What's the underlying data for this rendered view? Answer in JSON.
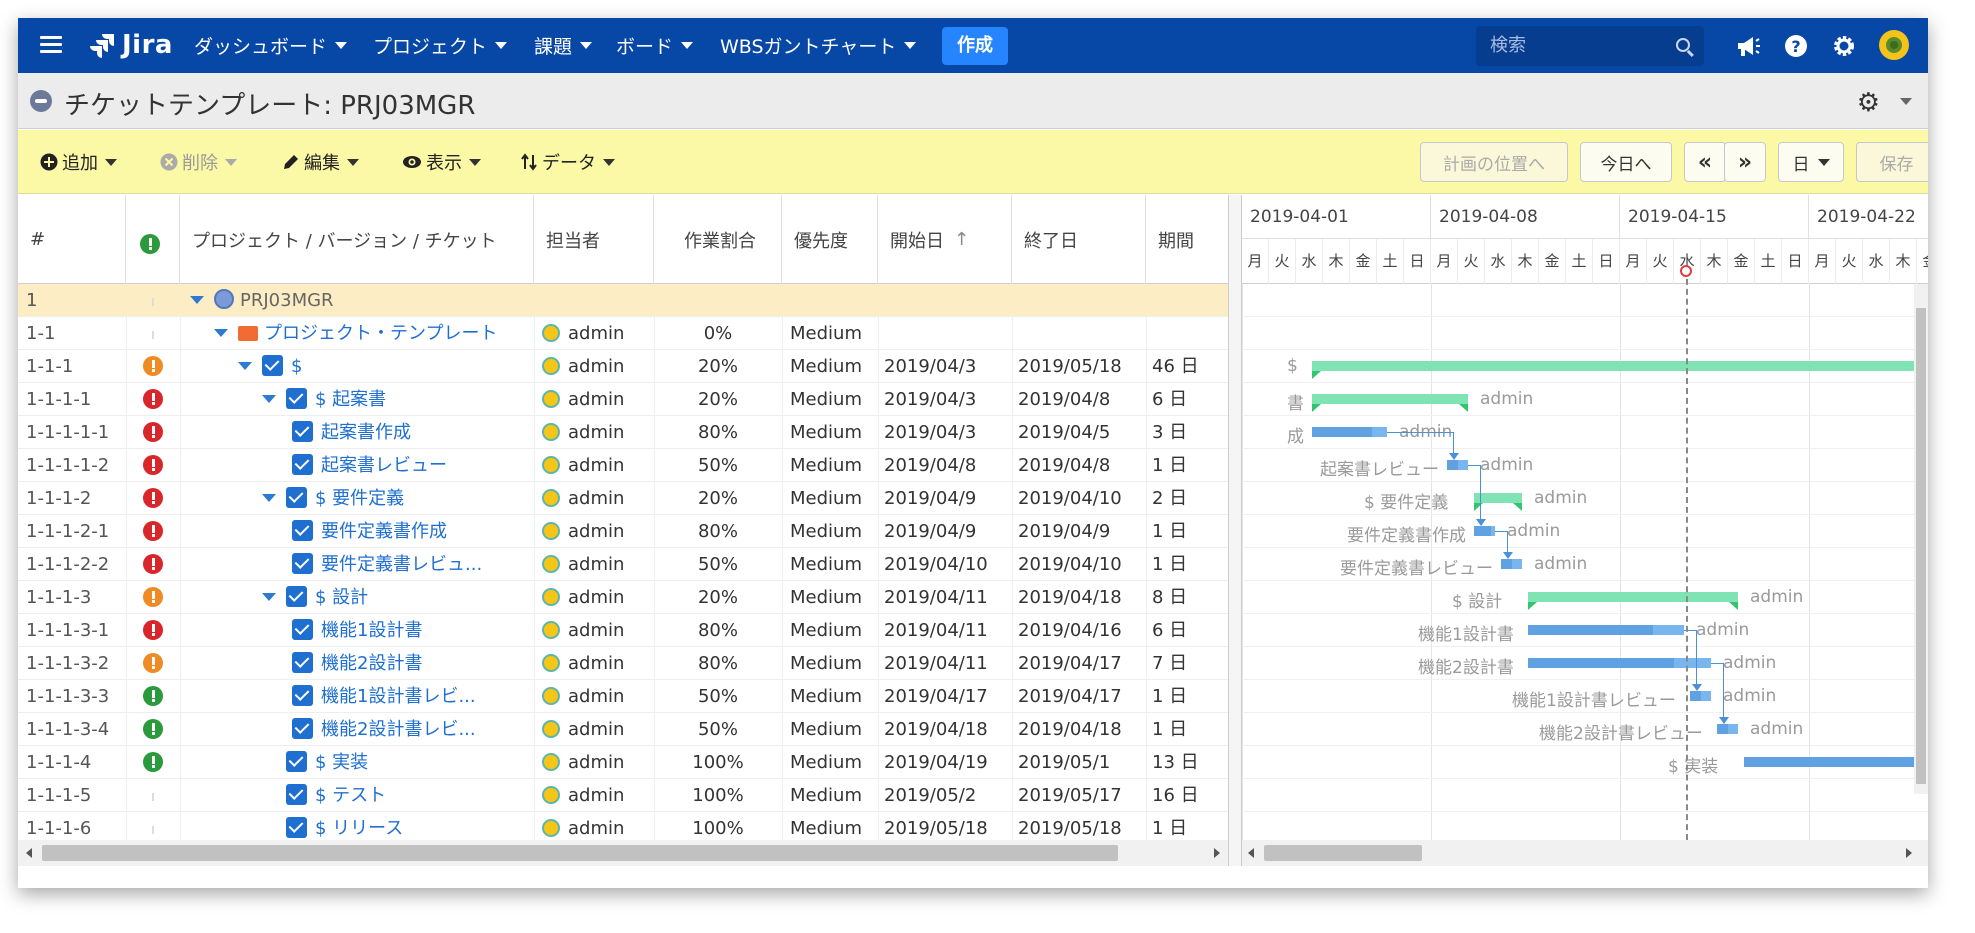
{
  "nav": {
    "brand": "Jira",
    "menus": [
      "ダッシュボード",
      "プロジェクト",
      "課題",
      "ボード",
      "WBSガントチャート"
    ],
    "create_label": "作成",
    "search_placeholder": "検索",
    "icons": [
      "notifications-icon",
      "help-icon",
      "settings-icon",
      "user-avatar"
    ],
    "accent": "#0747a6"
  },
  "page": {
    "title": "チケットテンプレート: PRJ03MGR"
  },
  "toolbar": {
    "add": "追加",
    "delete": "削除",
    "edit": "編集",
    "view": "表示",
    "data": "データ",
    "plan_position": "計画の位置へ",
    "today": "今日へ",
    "prev": "«",
    "next": "»",
    "unit": "日",
    "save": "保存",
    "background": "#fbf8a6"
  },
  "columns": {
    "num": "#",
    "key": "プロジェクト / バージョン / チケット",
    "assignee": "担当者",
    "progress": "作業割合",
    "priority": "優先度",
    "start": "開始日",
    "start_sort": "↑",
    "end": "終了日",
    "duration": "期間"
  },
  "rows": [
    {
      "num": "1",
      "pri": "none",
      "indent": 0,
      "tri": true,
      "chk": false,
      "icon": "project",
      "name": "PRJ03MGR",
      "link": false,
      "assignee": "",
      "progress": "",
      "priority": "",
      "start": "",
      "end": "",
      "duration": "",
      "selected": true
    },
    {
      "num": "1-1",
      "pri": "none",
      "indent": 1,
      "tri": true,
      "chk": false,
      "icon": "folder",
      "name": "プロジェクト・テンプレート",
      "link": true,
      "assignee": "admin",
      "progress": "0%",
      "priority": "Medium",
      "start": "",
      "end": "",
      "duration": ""
    },
    {
      "num": "1-1-1",
      "pri": "orange",
      "indent": 2,
      "tri": true,
      "chk": true,
      "name": "$",
      "link": true,
      "assignee": "admin",
      "progress": "20%",
      "priority": "Medium",
      "start": "2019/04/3",
      "end": "2019/05/18",
      "duration": "46 日"
    },
    {
      "num": "1-1-1-1",
      "pri": "red",
      "indent": 3,
      "tri": true,
      "chk": true,
      "name": "$ 起案書",
      "link": true,
      "assignee": "admin",
      "progress": "20%",
      "priority": "Medium",
      "start": "2019/04/3",
      "end": "2019/04/8",
      "duration": "6 日"
    },
    {
      "num": "1-1-1-1-1",
      "pri": "red",
      "indent": 4,
      "tri": false,
      "chk": true,
      "name": "起案書作成",
      "link": true,
      "assignee": "admin",
      "progress": "80%",
      "priority": "Medium",
      "start": "2019/04/3",
      "end": "2019/04/5",
      "duration": "3 日"
    },
    {
      "num": "1-1-1-1-2",
      "pri": "red",
      "indent": 4,
      "tri": false,
      "chk": true,
      "name": "起案書レビュー",
      "link": true,
      "assignee": "admin",
      "progress": "50%",
      "priority": "Medium",
      "start": "2019/04/8",
      "end": "2019/04/8",
      "duration": "1 日"
    },
    {
      "num": "1-1-1-2",
      "pri": "red",
      "indent": 3,
      "tri": true,
      "chk": true,
      "name": "$ 要件定義",
      "link": true,
      "assignee": "admin",
      "progress": "20%",
      "priority": "Medium",
      "start": "2019/04/9",
      "end": "2019/04/10",
      "duration": "2 日"
    },
    {
      "num": "1-1-1-2-1",
      "pri": "red",
      "indent": 4,
      "tri": false,
      "chk": true,
      "name": "要件定義書作成",
      "link": true,
      "assignee": "admin",
      "progress": "80%",
      "priority": "Medium",
      "start": "2019/04/9",
      "end": "2019/04/9",
      "duration": "1 日"
    },
    {
      "num": "1-1-1-2-2",
      "pri": "red",
      "indent": 4,
      "tri": false,
      "chk": true,
      "name": "要件定義書レビュ...",
      "link": true,
      "assignee": "admin",
      "progress": "50%",
      "priority": "Medium",
      "start": "2019/04/10",
      "end": "2019/04/10",
      "duration": "1 日"
    },
    {
      "num": "1-1-1-3",
      "pri": "orange",
      "indent": 3,
      "tri": true,
      "chk": true,
      "name": "$ 設計",
      "link": true,
      "assignee": "admin",
      "progress": "20%",
      "priority": "Medium",
      "start": "2019/04/11",
      "end": "2019/04/18",
      "duration": "8 日"
    },
    {
      "num": "1-1-1-3-1",
      "pri": "red",
      "indent": 4,
      "tri": false,
      "chk": true,
      "name": "機能1設計書",
      "link": true,
      "assignee": "admin",
      "progress": "80%",
      "priority": "Medium",
      "start": "2019/04/11",
      "end": "2019/04/16",
      "duration": "6 日"
    },
    {
      "num": "1-1-1-3-2",
      "pri": "orange",
      "indent": 4,
      "tri": false,
      "chk": true,
      "name": "機能2設計書",
      "link": true,
      "assignee": "admin",
      "progress": "80%",
      "priority": "Medium",
      "start": "2019/04/11",
      "end": "2019/04/17",
      "duration": "7 日"
    },
    {
      "num": "1-1-1-3-3",
      "pri": "green",
      "indent": 4,
      "tri": false,
      "chk": true,
      "name": "機能1設計書レビ...",
      "link": true,
      "assignee": "admin",
      "progress": "50%",
      "priority": "Medium",
      "start": "2019/04/17",
      "end": "2019/04/17",
      "duration": "1 日"
    },
    {
      "num": "1-1-1-3-4",
      "pri": "green",
      "indent": 4,
      "tri": false,
      "chk": true,
      "name": "機能2設計書レビ...",
      "link": true,
      "assignee": "admin",
      "progress": "50%",
      "priority": "Medium",
      "start": "2019/04/18",
      "end": "2019/04/18",
      "duration": "1 日"
    },
    {
      "num": "1-1-1-4",
      "pri": "green",
      "indent": 3,
      "tri": false,
      "chk": true,
      "name": "$ 実装",
      "link": true,
      "assignee": "admin",
      "progress": "100%",
      "priority": "Medium",
      "start": "2019/04/19",
      "end": "2019/05/1",
      "duration": "13 日"
    },
    {
      "num": "1-1-1-5",
      "pri": "none",
      "indent": 3,
      "tri": false,
      "chk": true,
      "name": "$ テスト",
      "link": true,
      "assignee": "admin",
      "progress": "100%",
      "priority": "Medium",
      "start": "2019/05/2",
      "end": "2019/05/17",
      "duration": "16 日"
    },
    {
      "num": "1-1-1-6",
      "pri": "none",
      "indent": 3,
      "tri": false,
      "chk": true,
      "name": "$ リリース",
      "link": true,
      "assignee": "admin",
      "progress": "100%",
      "priority": "Medium",
      "start": "2019/05/18",
      "end": "2019/05/18",
      "duration": "1 日"
    }
  ],
  "gantt": {
    "weeks": [
      "2019-04-01",
      "2019-04-08",
      "2019-04-15",
      "2019-04-22"
    ],
    "day_names": [
      "月",
      "火",
      "水",
      "木",
      "金",
      "土",
      "日"
    ],
    "colors": {
      "summary": "#7fe3b3",
      "summary_done": "#33c46f",
      "task": "#7ab6ee",
      "task_done": "#4a90d9",
      "today": "#e23c3c"
    },
    "labels": [
      {
        "text": "$",
        "row": 2
      },
      {
        "text": "書",
        "row": 3
      },
      {
        "text": "admin",
        "row": 3
      },
      {
        "text": "成",
        "row": 4
      },
      {
        "text": "admin",
        "row": 4
      },
      {
        "text": "起案書レビュー",
        "row": 5
      },
      {
        "text": "admin",
        "row": 5
      },
      {
        "text": "$ 要件定義",
        "row": 6
      },
      {
        "text": "admin",
        "row": 6
      },
      {
        "text": "要件定義書作成",
        "row": 7
      },
      {
        "text": "admin",
        "row": 7
      },
      {
        "text": "要件定義書レビュー",
        "row": 8
      },
      {
        "text": "admin",
        "row": 8
      },
      {
        "text": "$ 設計",
        "row": 9
      },
      {
        "text": "admin",
        "row": 9
      },
      {
        "text": "機能1設計書",
        "row": 10
      },
      {
        "text": "admin",
        "row": 10
      },
      {
        "text": "機能2設計書",
        "row": 11
      },
      {
        "text": "admin",
        "row": 11
      },
      {
        "text": "機能1設計書レビュー",
        "row": 12
      },
      {
        "text": "admin",
        "row": 12
      },
      {
        "text": "機能2設計書レビュー",
        "row": 13
      },
      {
        "text": "admin",
        "row": 13
      },
      {
        "text": "$ 実装",
        "row": 14
      }
    ]
  }
}
